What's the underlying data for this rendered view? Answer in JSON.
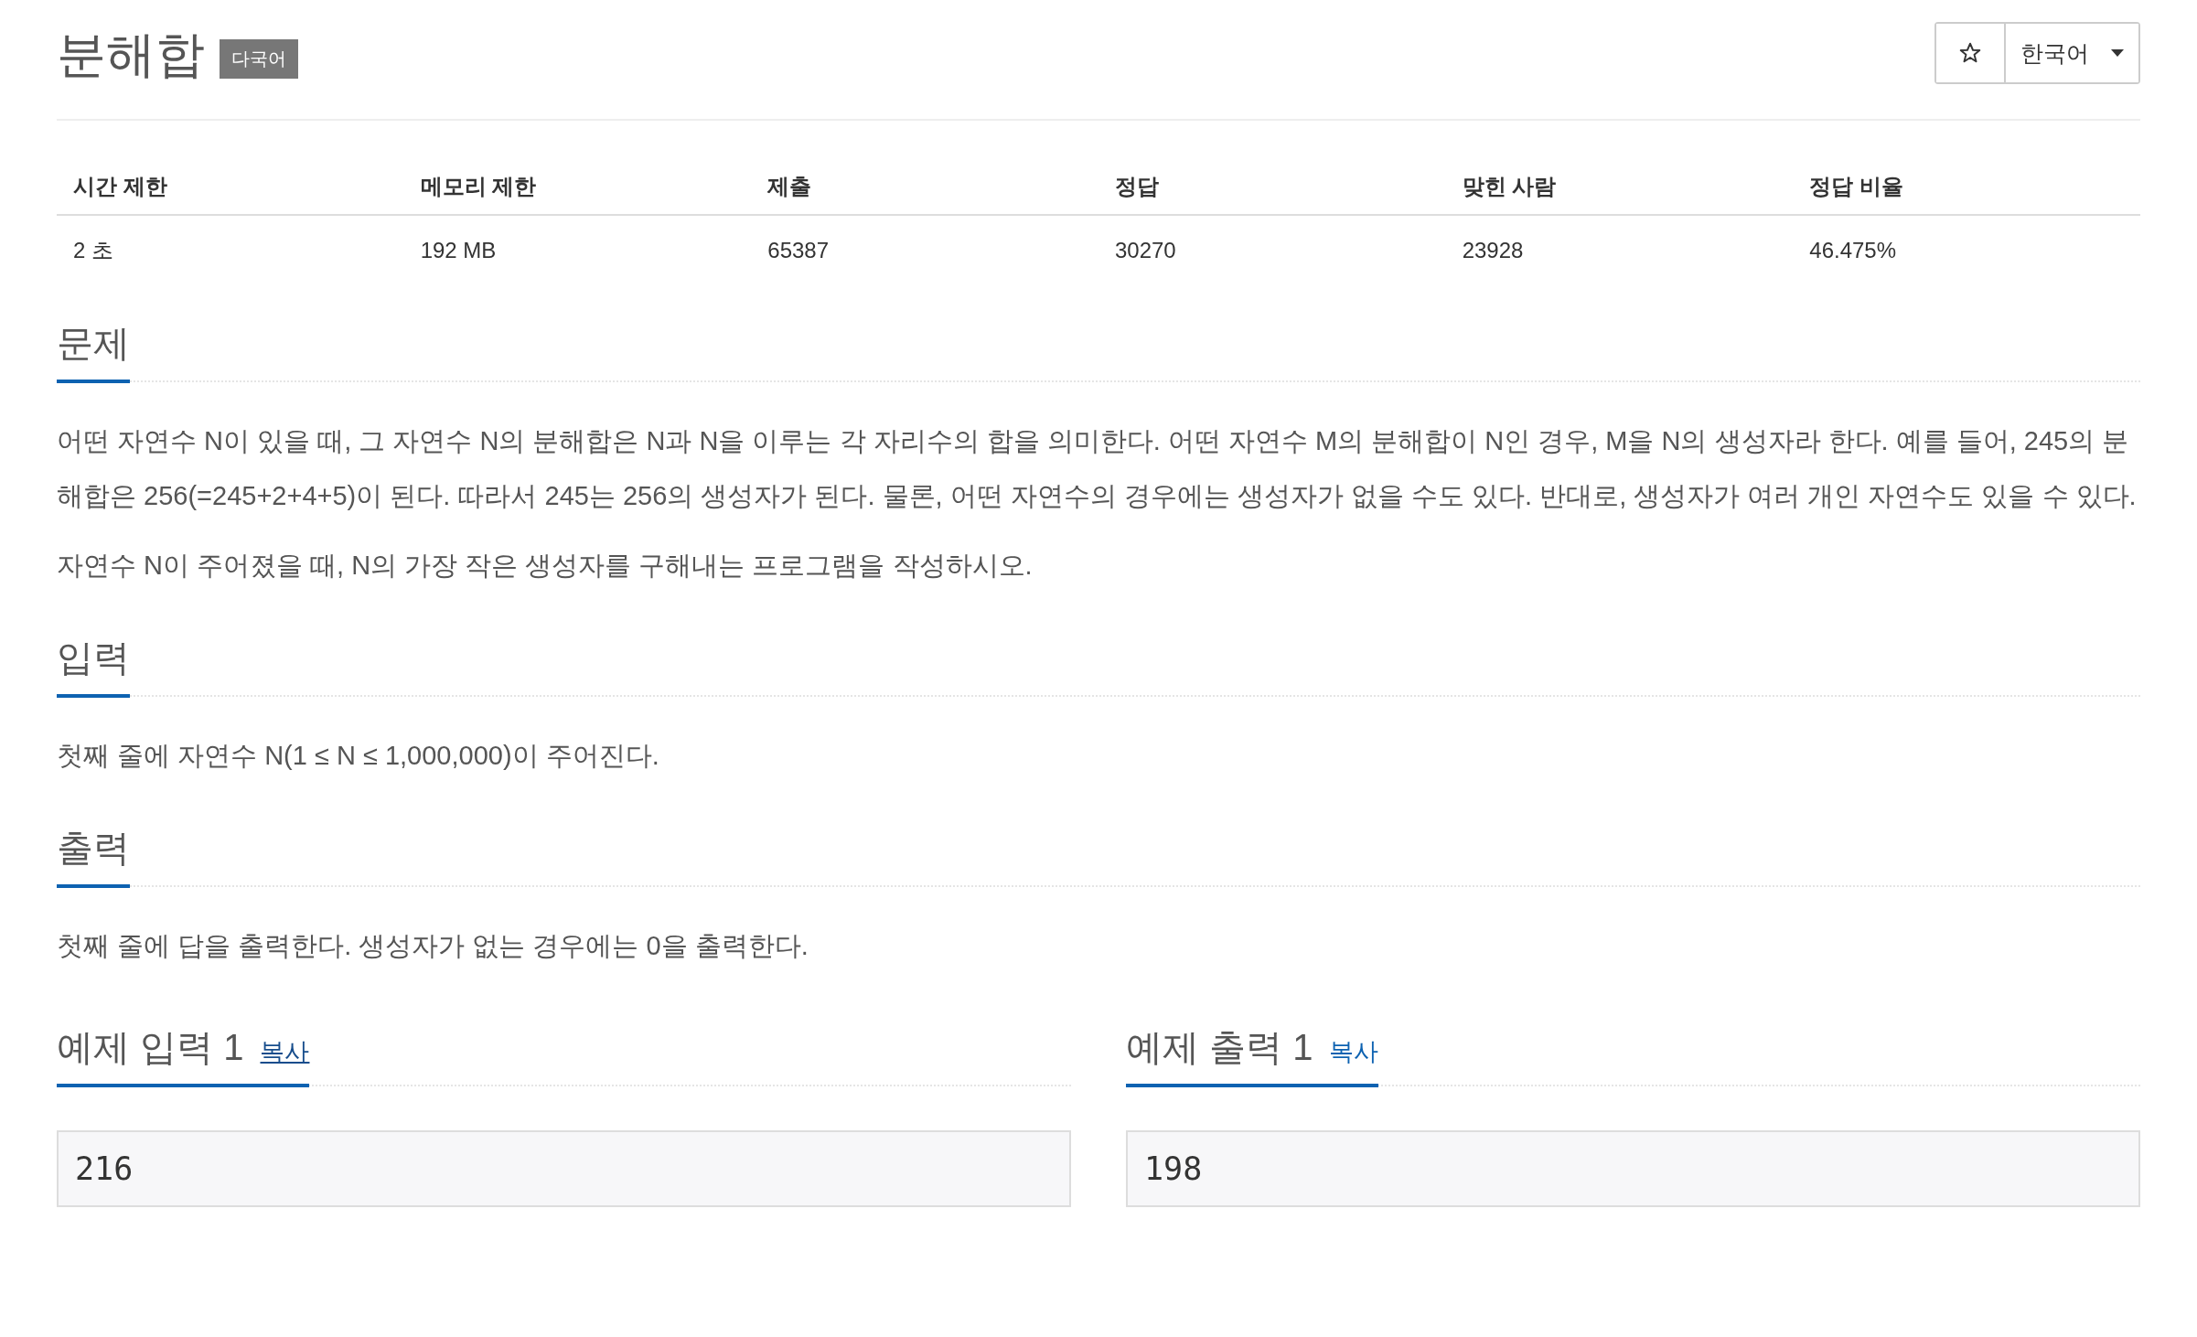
{
  "header": {
    "title": "분해합",
    "badge": "다국어",
    "language": "한국어"
  },
  "info_table": {
    "columns": [
      "시간 제한",
      "메모리 제한",
      "제출",
      "정답",
      "맞힌 사람",
      "정답 비율"
    ],
    "rows": [
      [
        "2 초",
        "192 MB",
        "65387",
        "30270",
        "23928",
        "46.475%"
      ]
    ]
  },
  "sections": [
    {
      "heading": "문제",
      "paragraphs": [
        "어떤 자연수 N이 있을 때, 그 자연수 N의 분해합은 N과 N을 이루는 각 자리수의 합을 의미한다. 어떤 자연수 M의 분해합이 N인 경우, M을 N의 생성자라 한다. 예를 들어, 245의 분해합은 256(=245+2+4+5)이 된다. 따라서 245는 256의 생성자가 된다. 물론, 어떤 자연수의 경우에는 생성자가 없을 수도 있다. 반대로, 생성자가 여러 개인 자연수도 있을 수 있다.",
        "자연수 N이 주어졌을 때, N의 가장 작은 생성자를 구해내는 프로그램을 작성하시오."
      ]
    },
    {
      "heading": "입력",
      "paragraphs": [
        "첫째 줄에 자연수 N(1 ≤ N ≤ 1,000,000)이 주어진다."
      ]
    },
    {
      "heading": "출력",
      "paragraphs": [
        "첫째 줄에 답을 출력한다. 생성자가 없는 경우에는 0을 출력한다."
      ]
    }
  ],
  "samples": [
    {
      "heading": "예제 입력 1",
      "copy_link": "복사",
      "hovered": true,
      "value": "216"
    },
    {
      "heading": "예제 출력 1",
      "copy_link": "복사",
      "hovered": false,
      "value": "198"
    }
  ]
}
